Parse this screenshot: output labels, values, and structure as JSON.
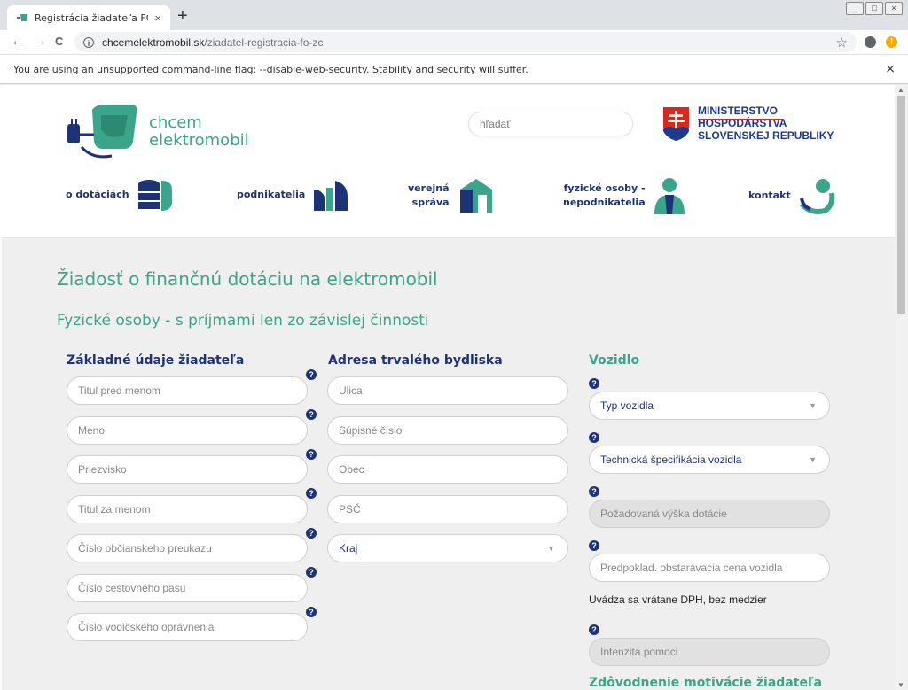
{
  "browser": {
    "tab_title": "Registrácia žiadateľa FO-s príjma",
    "new_tab": "+",
    "tab_close": "×",
    "url_domain": "chcemelektromobil.sk",
    "url_path": "/ziadatel-registracia-fo-zc",
    "infobar_text": "You are using an unsupported command-line flag: --disable-web-security. Stability and security will suffer.",
    "infobar_close": "×",
    "back": "←",
    "forward": "→",
    "reload": "C",
    "star": "☆",
    "alert": "!"
  },
  "header": {
    "logo_line1": "chcem",
    "logo_line2": "elektromobil",
    "search_placeholder": "hľadať",
    "ministry_line1": "MINISTERSTVO",
    "ministry_line2": "HOSPODÁRSTVA",
    "ministry_line3": "SLOVENSKEJ REPUBLIKY"
  },
  "nav": {
    "item1": "o dotáciách",
    "item2": "podnikatelia",
    "item3_line1": "verejná",
    "item3_line2": "správa",
    "item4_line1": "fyzické osoby -",
    "item4_line2": "nepodnikatelia",
    "item5": "kontakt"
  },
  "form": {
    "title": "Žiadosť o finančnú dotáciu na elektromobil",
    "subtitle": "Fyzické osoby - s príjmami len zo závislej činnosti",
    "help": "?",
    "col1": {
      "title": "Základné údaje žiadateľa",
      "fields": [
        "Titul pred menom",
        "Meno",
        "Priezvisko",
        "Titul za menom",
        "Číslo občianskeho preukazu",
        "Číslo cestovného pasu",
        "Číslo vodičského oprávnenia"
      ]
    },
    "col2": {
      "title": "Adresa trvalého bydliska",
      "fields": [
        "Ulica",
        "Súpisné číslo",
        "Obec",
        "PSČ"
      ],
      "select": "Kraj"
    },
    "col3": {
      "title": "Vozidlo",
      "vehicle_type": "Typ vozidla",
      "tech_spec": "Technická špecifikácia vozidla",
      "requested_amount": "Požadovaná výška dotácie",
      "price": "Predpoklad. obstarávacia cena vozidla",
      "price_note": "Uvádza sa vrátane DPH, bez medzier",
      "intensity": "Intenzita pomoci",
      "motivation_title": "Zdôvodnenie motivácie žiadateľa"
    }
  },
  "colors": {
    "green": "#3aa58a",
    "navy": "#1c3378",
    "background": "#efefef"
  }
}
